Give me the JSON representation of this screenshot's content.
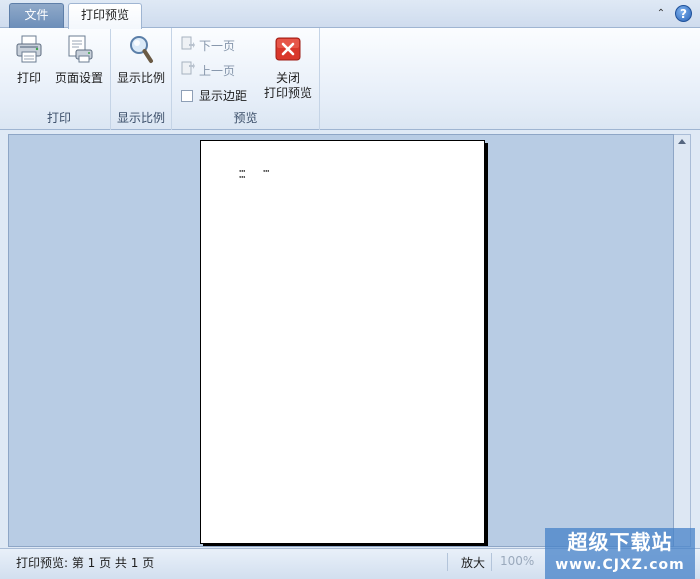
{
  "tabs": {
    "file": "文件",
    "print_preview": "打印预览"
  },
  "ribbon": {
    "print_group": {
      "label": "打印",
      "print_button": "打印",
      "page_setup_button": "页面设置"
    },
    "zoom_group": {
      "label": "显示比例",
      "zoom_button": "显示比例"
    },
    "preview_group": {
      "label": "预览",
      "next_page": "下一页",
      "previous_page": "上一页",
      "show_margins": "显示边距",
      "close_line1": "关闭",
      "close_line2": "打印预览"
    }
  },
  "page": {
    "cells": [
      "333",
      "333",
      "334"
    ]
  },
  "statusbar": {
    "status_text": "打印预览: 第 1 页  共 1 页",
    "zoom_in": "放大",
    "zoom_level": "100%"
  },
  "watermark": {
    "line1": "超级下载站",
    "line2": "www.CJXZ.com"
  },
  "colors": {
    "workspace_bg": "#b8cce4",
    "close_red": "#d9372b",
    "file_tab": "#7a99c2"
  }
}
